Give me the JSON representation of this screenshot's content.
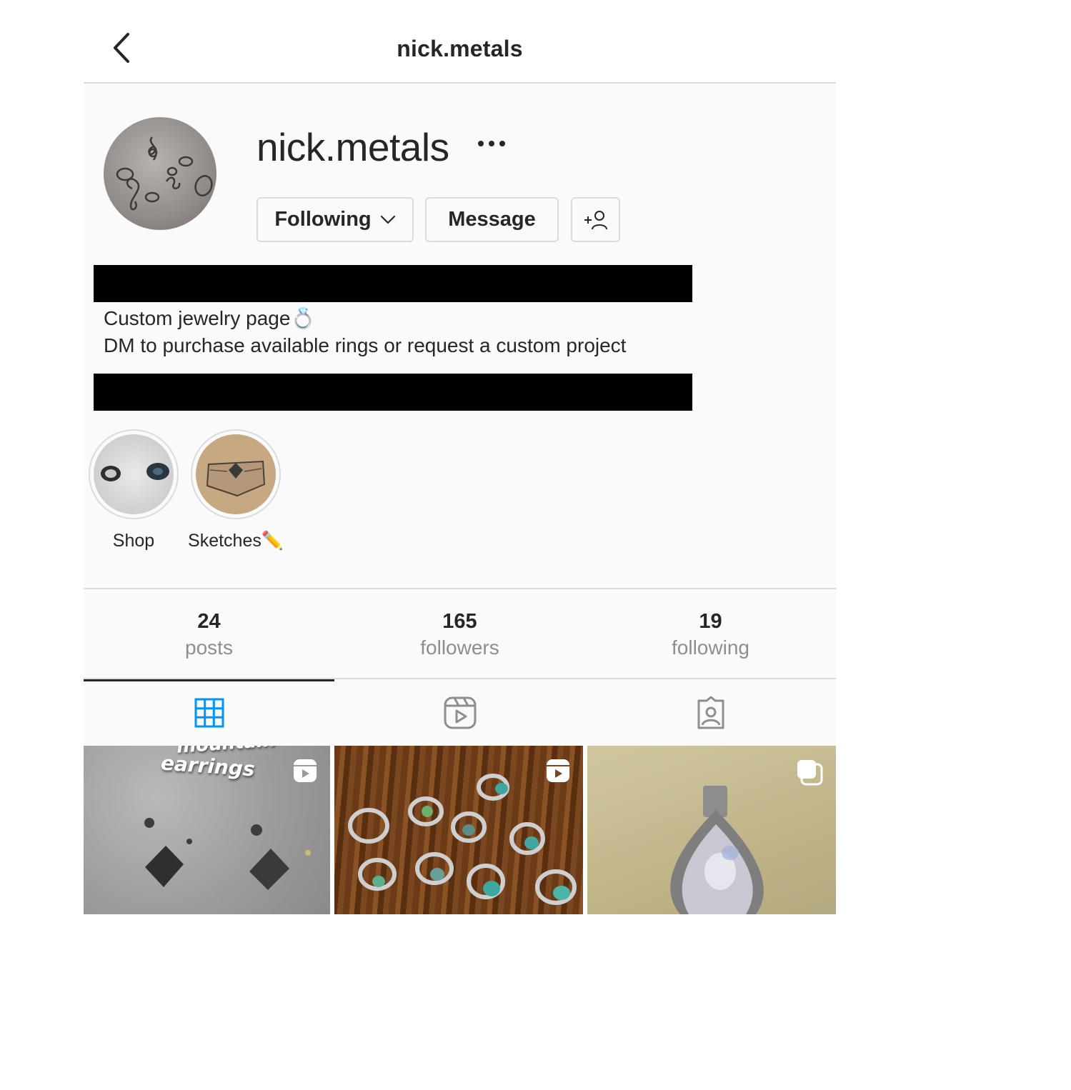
{
  "topbar": {
    "title": "nick.metals",
    "back_icon": "chevron-left-icon"
  },
  "profile": {
    "username": "nick.metals",
    "more_icon": "ellipsis-icon",
    "following_label": "Following",
    "message_label": "Message",
    "suggest_icon": "add-person-icon",
    "bio_line1": "Custom jewelry page💍",
    "bio_line2": "DM to purchase available rings or request a custom project"
  },
  "highlights": [
    {
      "label": "Shop"
    },
    {
      "label": "Sketches✏️"
    }
  ],
  "stats": {
    "posts_count": "24",
    "posts_label": "posts",
    "followers_count": "165",
    "followers_label": "followers",
    "following_count": "19",
    "following_label": "following"
  },
  "tabs": [
    {
      "name": "posts-grid",
      "icon": "grid-icon",
      "active": true
    },
    {
      "name": "reels",
      "icon": "reels-icon",
      "active": false
    },
    {
      "name": "tagged",
      "icon": "tagged-icon",
      "active": false
    }
  ],
  "posts": [
    {
      "overlay_text_top": "mountain",
      "overlay_text": "earrings",
      "badge_icon": "reels-icon"
    },
    {
      "overlay_text": "",
      "badge_icon": "reels-icon"
    },
    {
      "overlay_text": "",
      "badge_icon": "carousel-icon"
    }
  ],
  "colors": {
    "accent_blue": "#0095f6",
    "text_primary": "#262626",
    "text_secondary": "#8e8e8e",
    "border": "#dbdbdb",
    "background": "#fafafa"
  }
}
